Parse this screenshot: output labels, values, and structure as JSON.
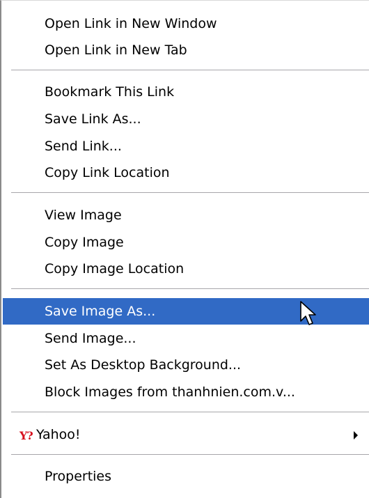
{
  "menu": {
    "items": [
      {
        "label": "Open Link in New Window"
      },
      {
        "label": "Open Link in New Tab"
      },
      {
        "label": "Bookmark This Link"
      },
      {
        "label": "Save Link As..."
      },
      {
        "label": "Send Link..."
      },
      {
        "label": "Copy Link Location"
      },
      {
        "label": "View Image"
      },
      {
        "label": "Copy Image"
      },
      {
        "label": "Copy Image Location"
      },
      {
        "label": "Save Image As..."
      },
      {
        "label": "Send Image..."
      },
      {
        "label": "Set As Desktop Background..."
      },
      {
        "label": "Block Images from thanhnien.com.v..."
      },
      {
        "label": "Yahoo!",
        "icon": "yahoo-logo-icon",
        "submenu": true
      },
      {
        "label": "Properties"
      }
    ],
    "selected": "Save Image As..."
  },
  "colors": {
    "highlight": "#316ac5",
    "separator": "#a7a6aa"
  }
}
